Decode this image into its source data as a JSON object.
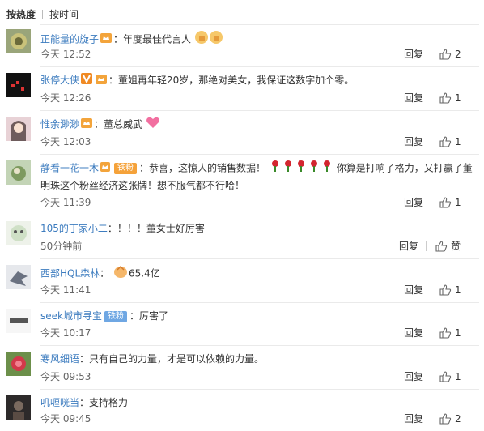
{
  "tabs": [
    "按热度",
    "按时间"
  ],
  "actions": {
    "reply": "回复",
    "like_text": "赞"
  },
  "colors": {
    "username": "#eb7350",
    "username_alt": "#3d7cbf",
    "fan_badge": "#6fa7e3"
  },
  "comments": [
    {
      "user": "正能量的旋子",
      "sep": "：",
      "text": "年度最佳代言人",
      "time": "今天 12:52",
      "likes": "2",
      "emoji": [
        "thumbs-up",
        "thumbs-up"
      ]
    },
    {
      "user": "张停大侠",
      "sep": "：",
      "text": "董姐再年轻20岁，那绝对美女，我保证这数字加个零。",
      "time": "今天 12:26",
      "likes": "1"
    },
    {
      "user": "惟余渺渺",
      "sep": "：",
      "text": "董总威武",
      "time": "今天 12:03",
      "likes": "1",
      "emoji": [
        "heart"
      ]
    },
    {
      "user": "静看一花一木",
      "badge": "铁粉",
      "sep": "：",
      "text": "恭喜，这惊人的销售数据！",
      "text2": "你算是打响了格力，又打赢了董明珠这个粉丝经济这张牌！想不服气都不行哈！",
      "time": "今天 11:39",
      "likes": "1",
      "emoji": [
        "rose",
        "rose",
        "rose",
        "rose",
        "rose"
      ]
    },
    {
      "user": "105的丁家小二",
      "sep": "：",
      "text": "！！！董女士好厉害",
      "time": "50分钟前",
      "likes": "赞"
    },
    {
      "user": "西部HQL森林",
      "sep": "：",
      "text": "65.4亿",
      "time": "今天 11:41",
      "likes": "1",
      "emoji": [
        "clap"
      ]
    },
    {
      "user": "seek城市寻宝",
      "badge": "铁粉",
      "sep": "：",
      "text": "厉害了",
      "time": "今天 10:17",
      "likes": "1"
    },
    {
      "user": "寒风细语",
      "sep": "：",
      "text": "只有自己的力量，才是可以依赖的力量。",
      "time": "今天 09:53",
      "likes": "1"
    },
    {
      "user": "叽喱咣当",
      "sep": "：",
      "text": "支持格力",
      "time": "今天 09:45",
      "likes": "2"
    }
  ]
}
